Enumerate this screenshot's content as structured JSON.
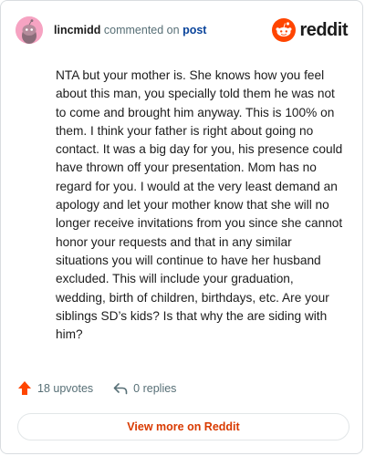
{
  "header": {
    "username": "lincmidd",
    "action_text": "commented on",
    "target_link": "post",
    "brand_name": "reddit"
  },
  "comment": {
    "text": "NTA but your mother is. She knows how you feel about this man, you specially told them he was not to come and brought him anyway. This is 100% on them. I think your father is right about going no contact. It was a big day for you, his presence could have thrown off your presentation. Mom has no regard for you. I would at the very least demand an apology and let your mother know that she will no longer receive invitations from you since she cannot honor your requests and that in any similar situations you will continue to have her husband excluded. This will include your graduation, wedding, birth of children, birthdays, etc. Are your siblings SD’s kids? Is that why the are siding with him?"
  },
  "actions": {
    "upvotes_label": "18 upvotes",
    "replies_label": "0 replies"
  },
  "footer": {
    "view_more_label": "View more on Reddit"
  },
  "icons": {
    "avatar": "snoo-avatar-icon",
    "brand": "reddit-logo-icon",
    "upvote": "upvote-arrow-icon",
    "reply": "reply-arrow-icon"
  },
  "colors": {
    "brand_orange": "#ff4500",
    "upvote_orange": "#ff4500",
    "link_blue": "#0a449b",
    "view_more_text": "#d93a00",
    "avatar_bg": "#f6a3c2",
    "muted_text": "#576f76"
  }
}
